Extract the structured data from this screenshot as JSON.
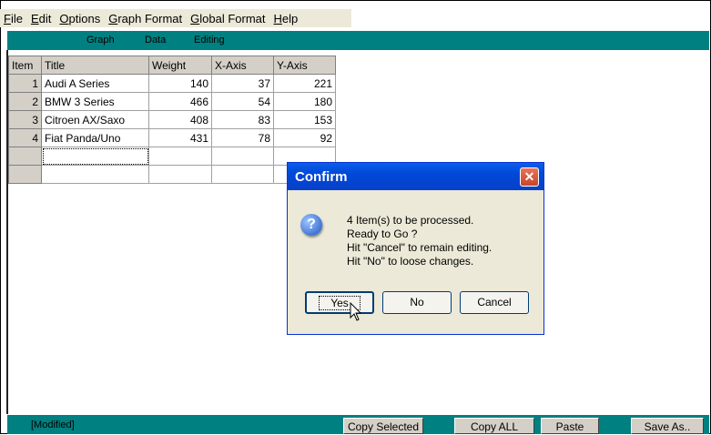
{
  "menu": [
    {
      "label": "File",
      "u": "F",
      "rest": "ile"
    },
    {
      "label": "Edit",
      "u": "E",
      "rest": "dit"
    },
    {
      "label": "Options",
      "u": "O",
      "rest": "ptions"
    },
    {
      "label": "Graph Format",
      "u": "G",
      "rest": "raph Format"
    },
    {
      "label": "Global Format",
      "u": "G",
      "rest": "lobal Format"
    },
    {
      "label": "Help",
      "u": "H",
      "rest": "elp"
    }
  ],
  "tabs": {
    "graph": "Graph",
    "data": "Data",
    "editing": "Editing"
  },
  "grid": {
    "headers": [
      "Item",
      "Title",
      "Weight",
      "X-Axis",
      "Y-Axis"
    ],
    "rows": [
      {
        "item": "1",
        "title": "Audi A Series",
        "weight": "140",
        "x": "37",
        "y": "221"
      },
      {
        "item": "2",
        "title": "BMW 3 Series",
        "weight": "466",
        "x": "54",
        "y": "180"
      },
      {
        "item": "3",
        "title": "Citroen AX/Saxo",
        "weight": "408",
        "x": "83",
        "y": "153"
      },
      {
        "item": "4",
        "title": "Fiat Panda/Uno",
        "weight": "431",
        "x": "78",
        "y": "92"
      }
    ]
  },
  "dialog": {
    "title": "Confirm",
    "close": "✕",
    "icon": "?",
    "message": [
      "4 Item(s) to be processed.",
      "Ready to Go ?",
      "Hit \"Cancel\" to remain editing.",
      "Hit \"No\" to loose changes."
    ],
    "yes": "Yes",
    "no": "No",
    "cancel": "Cancel"
  },
  "status": {
    "modified": "[Modified]"
  },
  "buttons": {
    "copy_selected": "Copy Selected",
    "copy_all": "Copy ALL",
    "paste": "Paste",
    "save_as": "Save As.."
  }
}
